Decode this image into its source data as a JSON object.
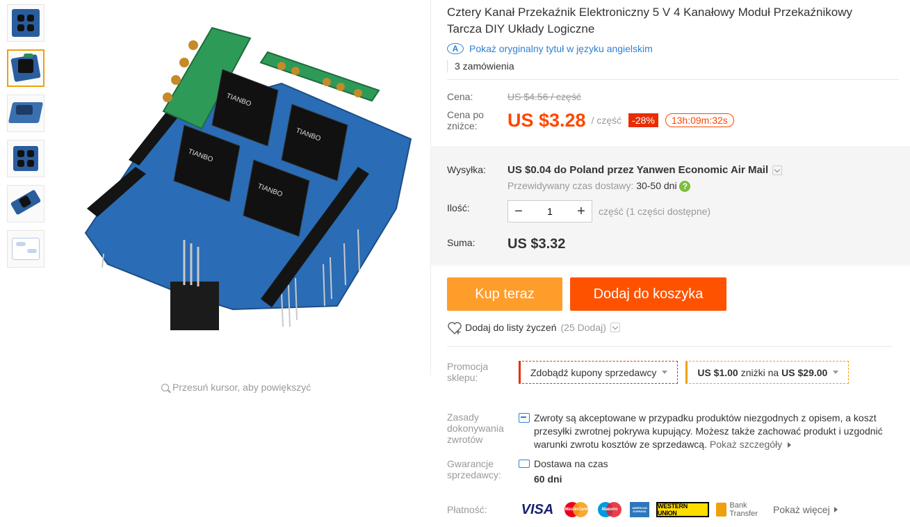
{
  "title": "Cztery Kanał Przekaźnik Elektroniczny 5 V 4 Kanałowy Moduł Przekaźnikowy Tarcza DIY Układy Logiczne",
  "orig_title_link": "Pokaż oryginalny tytuł w języku angielskim",
  "orders": "3 zamówienia",
  "zoom_hint": "Przesuń kursor, aby powiększyć",
  "price": {
    "label": "Cena:",
    "old": "US $4.56 / część",
    "discount_label": "Cena po zniżce:",
    "new": "US $3.28",
    "unit": "/ część",
    "discount": "-28%",
    "timer": "13h:09m:32s"
  },
  "shipping": {
    "label": "Wysyłka:",
    "cost": "US $0.04 do",
    "destination": "Poland przez Yanwen Economic Air Mail",
    "delivery_label": "Przewidywany czas dostawy:",
    "delivery_time": "30-50 dni"
  },
  "quantity": {
    "label": "Ilość:",
    "value": "1",
    "minus": "−",
    "plus": "+",
    "note": "część (1 części dostępne)"
  },
  "total": {
    "label": "Suma:",
    "value": "US $3.32"
  },
  "buttons": {
    "buy_now": "Kup teraz",
    "add_to_cart": "Dodaj do koszyka"
  },
  "wishlist": {
    "label": "Dodaj do listy życzeń",
    "count": "(25 Dodaj)"
  },
  "promo": {
    "label": "Promocja sklepu:",
    "coupons": "Zdobądź kupony sprzedawcy",
    "deal_amount": "US $1.00",
    "deal_text": "zniżki na",
    "deal_threshold": "US $29.00"
  },
  "returns": {
    "label": "Zasady dokonywania zwrotów",
    "text": "Zwroty są akceptowane w przypadku produktów niezgodnych z opisem, a koszt przesyłki zwrotnej pokrywa kupujący. Możesz także zachować produkt i uzgodnić warunki zwrotu kosztów ze sprzedawcą.",
    "details_link": "Pokaż szczegóły"
  },
  "guarantee": {
    "label": "Gwarancje sprzedawcy:",
    "text": "Dostawa na czas",
    "days": "60 dni"
  },
  "payment": {
    "label": "Płatność:",
    "visa": "VISA",
    "mastercard": "MasterCard",
    "maestro": "Maestro",
    "amex": "AMERICAN EXPRESS",
    "wu": "WESTERN UNION",
    "bank": "Bank Transfer",
    "more": "Pokaż więcej"
  },
  "colors": {
    "accent_orange": "#ff4700",
    "buy_button": "#ff9d2b",
    "cart_button": "#ff5200",
    "link_blue": "#2f80d1"
  }
}
